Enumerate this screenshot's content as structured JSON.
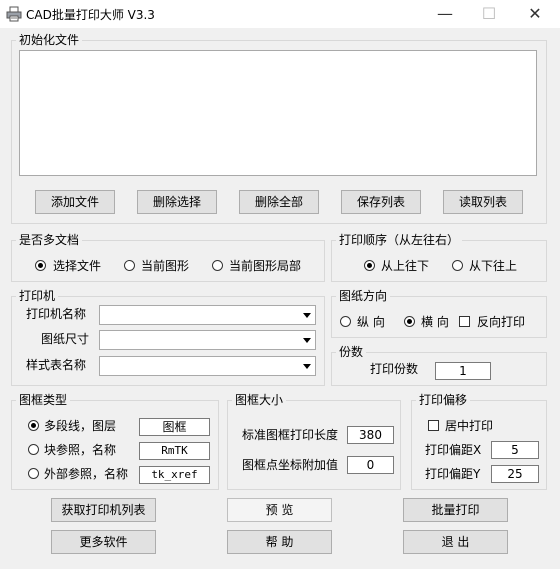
{
  "window": {
    "title": "CAD批量打印大师 V3.3",
    "minimize_glyph": "—",
    "maximize_glyph": "☐",
    "close_glyph": "✕",
    "app_icon": "printer-icon"
  },
  "init_files": {
    "label": "初始化文件",
    "buttons": [
      "添加文件",
      "删除选择",
      "删除全部",
      "保存列表",
      "读取列表"
    ]
  },
  "multi_doc": {
    "label": "是否多文档",
    "options": [
      "选择文件",
      "当前图形",
      "当前图形局部"
    ],
    "selected": "选择文件"
  },
  "print_order": {
    "label": "打印顺序（从左往右）",
    "options": [
      "从上往下",
      "从下往上"
    ],
    "selected": "从上往下"
  },
  "printer": {
    "label": "打印机",
    "printer_name_label": "打印机名称",
    "paper_size_label": "图纸尺寸",
    "style_table_label": "样式表名称",
    "printer_name_value": "",
    "paper_size_value": "",
    "style_table_value": ""
  },
  "paper_direction": {
    "label": "图纸方向",
    "options": [
      "纵 向",
      "横 向"
    ],
    "selected": "横 向",
    "reverse_label": "反向打印",
    "reverse_checked": false
  },
  "copies": {
    "label": "份数",
    "copies_label": "打印份数",
    "copies_value": "1"
  },
  "frame_type": {
    "label": "图框类型",
    "options": [
      "多段线，图层",
      "块参照，名称",
      "外部参照，名称"
    ],
    "selected": "多段线，图层",
    "values": [
      "图框",
      "RmTK",
      "tk_xref"
    ]
  },
  "frame_size": {
    "label": "图框大小",
    "std_length_label": "标准图框打印长度",
    "std_length_value": "380",
    "point_add_label": "图框点坐标附加值",
    "point_add_value": "0"
  },
  "print_offset": {
    "label": "打印偏移",
    "center_label": "居中打印",
    "center_checked": false,
    "offset_x_label": "打印偏距X",
    "offset_x_value": "5",
    "offset_y_label": "打印偏距Y",
    "offset_y_value": "25"
  },
  "bottom_buttons": {
    "get_printers": "获取打印机列表",
    "preview": "预 览",
    "batch_print": "批量打印",
    "more_software": "更多软件",
    "help": "帮 助",
    "exit": "退 出"
  }
}
